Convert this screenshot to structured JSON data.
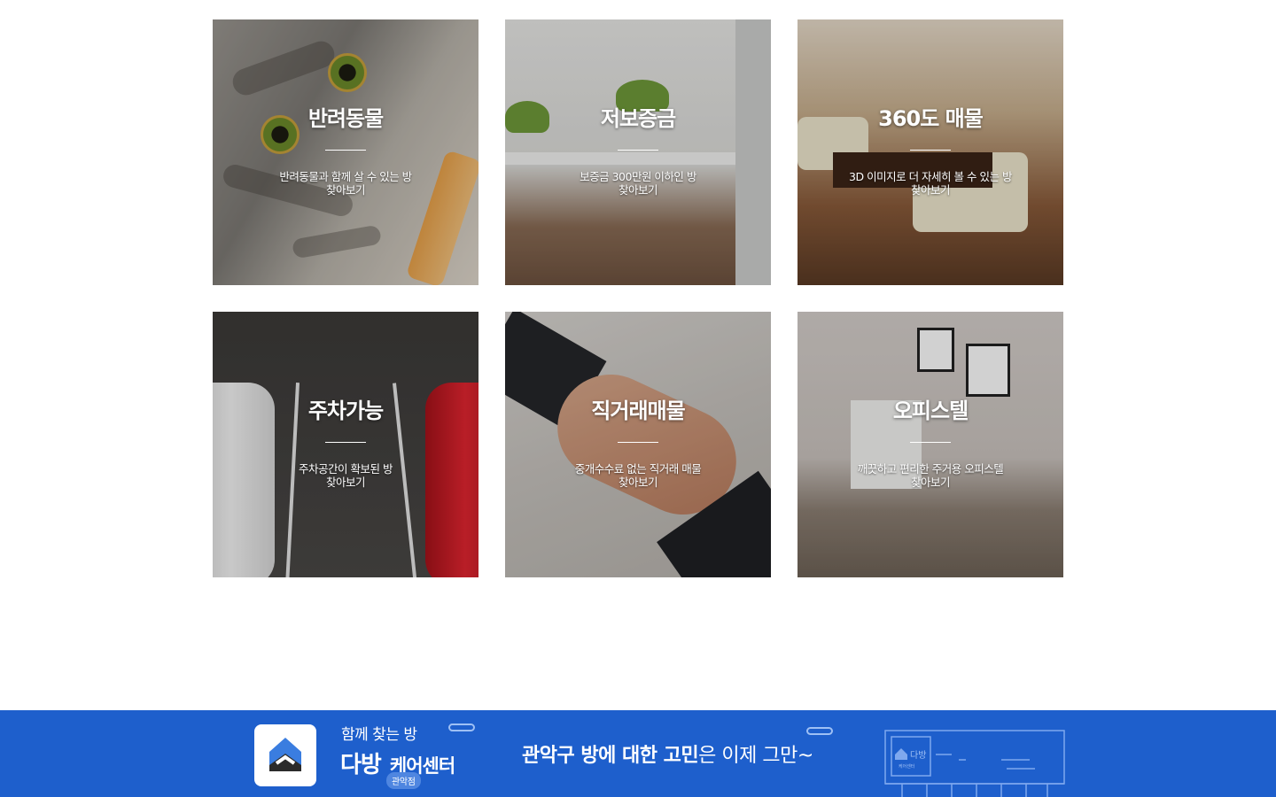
{
  "cards": [
    {
      "title": "반려동물",
      "desc": "반려동물과 함께 살 수 있는 방",
      "cta": "찾아보기"
    },
    {
      "title": "저보증금",
      "desc": "보증금 300만원 이하인 방",
      "cta": "찾아보기"
    },
    {
      "title": "360도 매물",
      "desc": "3D 이미지로 더 자세히 볼 수 있는 방",
      "cta": "찾아보기"
    },
    {
      "title": "주차가능",
      "desc": "주차공간이 확보된 방",
      "cta": "찾아보기"
    },
    {
      "title": "직거래매물",
      "desc": "중개수수료 없는 직거래 매물",
      "cta": "찾아보기"
    },
    {
      "title": "오피스텔",
      "desc": "깨끗하고 편리한 주거용 오피스텔",
      "cta": "찾아보기"
    }
  ],
  "banner": {
    "tagline": "함께 찾는 방",
    "brand": "다방",
    "brand_sub": "케어센터",
    "branch": "관악점",
    "slogan_bold": "관악구 방에 대한 고민",
    "slogan_rest": "은 이제 그만~",
    "deco_brand": "다방",
    "deco_sub": "케어센터",
    "bg_color": "#1e5fcc"
  }
}
